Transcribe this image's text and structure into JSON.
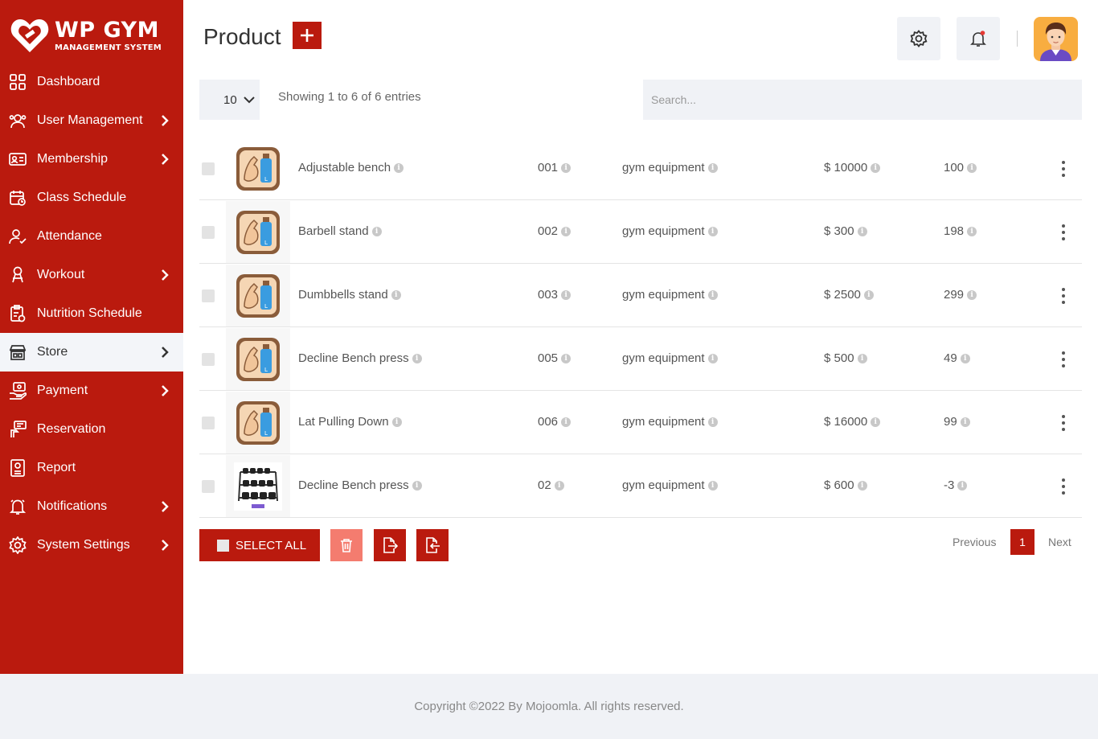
{
  "brand": {
    "title": "WP GYM",
    "subtitle": "MANAGEMENT SYSTEM",
    "color": "#ba1a0e"
  },
  "sidebar": {
    "items": [
      {
        "label": "Dashboard",
        "icon": "dashboard-icon",
        "has_submenu": false
      },
      {
        "label": "User Management",
        "icon": "users-icon",
        "has_submenu": true
      },
      {
        "label": "Membership",
        "icon": "membership-card-icon",
        "has_submenu": true
      },
      {
        "label": "Class Schedule",
        "icon": "calendar-icon",
        "has_submenu": false
      },
      {
        "label": "Attendance",
        "icon": "user-check-icon",
        "has_submenu": false
      },
      {
        "label": "Workout",
        "icon": "workout-icon",
        "has_submenu": true
      },
      {
        "label": "Nutrition Schedule",
        "icon": "nutrition-icon",
        "has_submenu": false
      },
      {
        "label": "Store",
        "icon": "store-icon",
        "has_submenu": true,
        "active": true
      },
      {
        "label": "Payment",
        "icon": "payment-icon",
        "has_submenu": true
      },
      {
        "label": "Reservation",
        "icon": "reservation-icon",
        "has_submenu": false
      },
      {
        "label": "Report",
        "icon": "report-icon",
        "has_submenu": false
      },
      {
        "label": "Notifications",
        "icon": "bell-icon",
        "has_submenu": true
      },
      {
        "label": "System Settings",
        "icon": "gear-icon",
        "has_submenu": true
      }
    ]
  },
  "header": {
    "title": "Product",
    "add_icon": "plus-icon",
    "settings_icon": "gear-icon",
    "notification_icon": "bell-icon"
  },
  "controls": {
    "page_length": "10",
    "showing_text": "Showing 1 to 6 of 6 entries",
    "search_placeholder": "Search..."
  },
  "table": {
    "rows": [
      {
        "name": "Adjustable bench",
        "code": "001",
        "category": "gym equipment",
        "price": "$ 10000",
        "qty": "100",
        "image": "gym-app-icon"
      },
      {
        "name": "Barbell stand",
        "code": "002",
        "category": "gym equipment",
        "price": "$ 300",
        "qty": "198",
        "image": "gym-app-icon"
      },
      {
        "name": "Dumbbells stand",
        "code": "003",
        "category": "gym equipment",
        "price": "$ 2500",
        "qty": "299",
        "image": "gym-app-icon"
      },
      {
        "name": "Decline Bench press",
        "code": "005",
        "category": "gym equipment",
        "price": "$ 500",
        "qty": "49",
        "image": "gym-app-icon"
      },
      {
        "name": "Lat Pulling Down",
        "code": "006",
        "category": "gym equipment",
        "price": "$ 16000",
        "qty": "99",
        "image": "gym-app-icon"
      },
      {
        "name": "Decline Bench press",
        "code": "02",
        "category": "gym equipment",
        "price": "$ 600",
        "qty": "-3",
        "image": "dumbbell-rack-photo"
      }
    ]
  },
  "actions": {
    "select_all_label": "SELECT ALL",
    "delete_icon": "trash-icon",
    "export_icon": "export-file-icon",
    "import_icon": "import-file-icon"
  },
  "pagination": {
    "previous_label": "Previous",
    "current_page": "1",
    "next_label": "Next"
  },
  "footer": {
    "copyright": "Copyright ©2022 By Mojoomla. All rights reserved."
  }
}
